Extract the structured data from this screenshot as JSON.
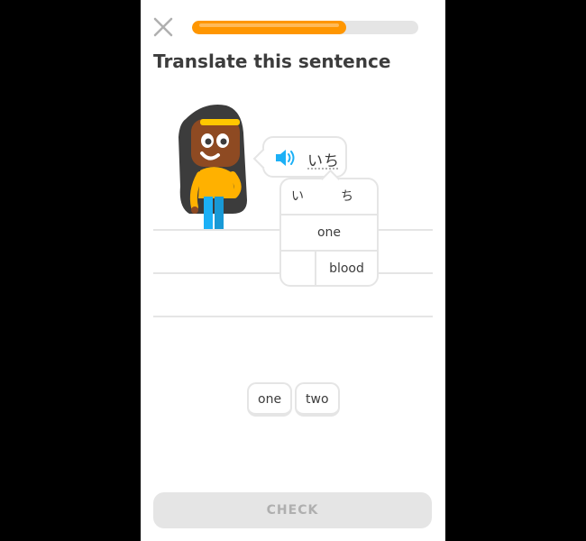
{
  "header": {
    "close_icon": "close-icon",
    "progress_fraction": 0.68,
    "progress_color": "#ff9600",
    "track_color": "#e5e5e5"
  },
  "exercise": {
    "title": "Translate this sentence",
    "prompt_word": "いち",
    "speaker_icon": "speaker-icon",
    "speaker_color": "#1cb0f6"
  },
  "hint_popup": {
    "characters": [
      "い",
      "ち"
    ],
    "translations": [
      "one",
      "blood"
    ]
  },
  "word_bank": [
    "one",
    "two"
  ],
  "footer": {
    "check_label": "CHECK"
  }
}
